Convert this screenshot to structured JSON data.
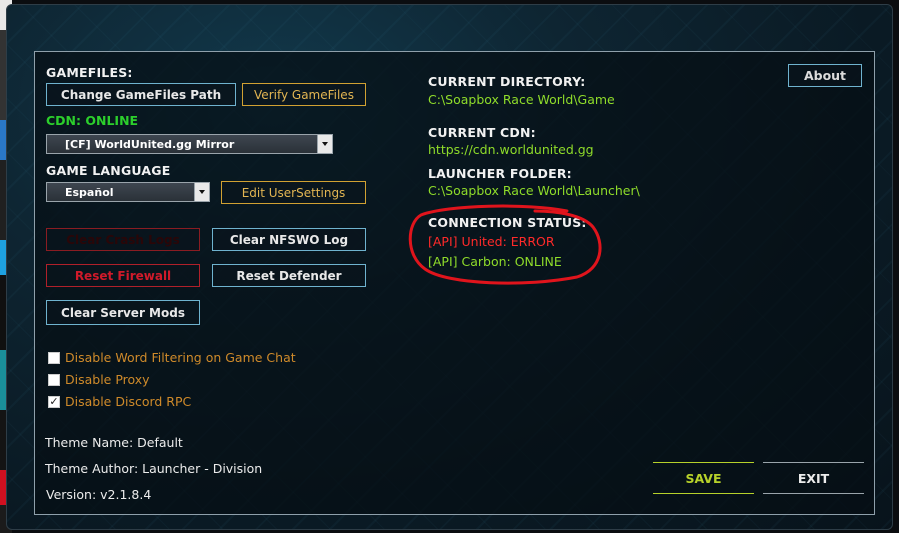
{
  "gamefiles": {
    "heading": "GAMEFILES:",
    "change_path_label": "Change GameFiles Path",
    "verify_label": "Verify GameFiles"
  },
  "cdn": {
    "status_label": "CDN: ONLINE",
    "selected": "[CF] WorldUnited.gg Mirror"
  },
  "language": {
    "heading": "GAME LANGUAGE",
    "selected": "Español",
    "edit_settings_label": "Edit UserSettings"
  },
  "actions": {
    "clear_crash_logs": "Clear Crash Logs",
    "clear_nfswo_log": "Clear NFSWO Log",
    "reset_firewall": "Reset Firewall",
    "reset_defender": "Reset Defender",
    "clear_server_mods": "Clear Server Mods"
  },
  "options": [
    {
      "label": "Disable Word Filtering on Game Chat",
      "checked": false
    },
    {
      "label": "Disable Proxy",
      "checked": false
    },
    {
      "label": "Disable Discord RPC",
      "checked": true
    }
  ],
  "theme": {
    "name_text": "Theme Name: Default",
    "author_text": "Theme Author: Launcher - Division",
    "version_text": "Version: v2.1.8.4"
  },
  "info": {
    "current_directory_label": "CURRENT DIRECTORY:",
    "current_directory_value": "C:\\Soapbox Race World\\Game",
    "current_cdn_label": "CURRENT CDN:",
    "current_cdn_value": "https://cdn.worldunited.gg",
    "launcher_folder_label": "LAUNCHER FOLDER:",
    "launcher_folder_value": "C:\\Soapbox Race World\\Launcher\\",
    "connection_status_label": "CONNECTION STATUS:",
    "api_united": "[API] United: ERROR",
    "api_carbon": "[API] Carbon: ONLINE"
  },
  "about_label": "About",
  "save_label": "SAVE",
  "exit_label": "EXIT",
  "colors": {
    "accent_border": "#6fb3cf",
    "gold": "#d1a132",
    "online_green": "#3fcf3a",
    "path_lime": "#8fdc2a",
    "error_red": "#ff2a2a",
    "save_yellow": "#b7d12a",
    "annotation_red": "#e0141c"
  }
}
